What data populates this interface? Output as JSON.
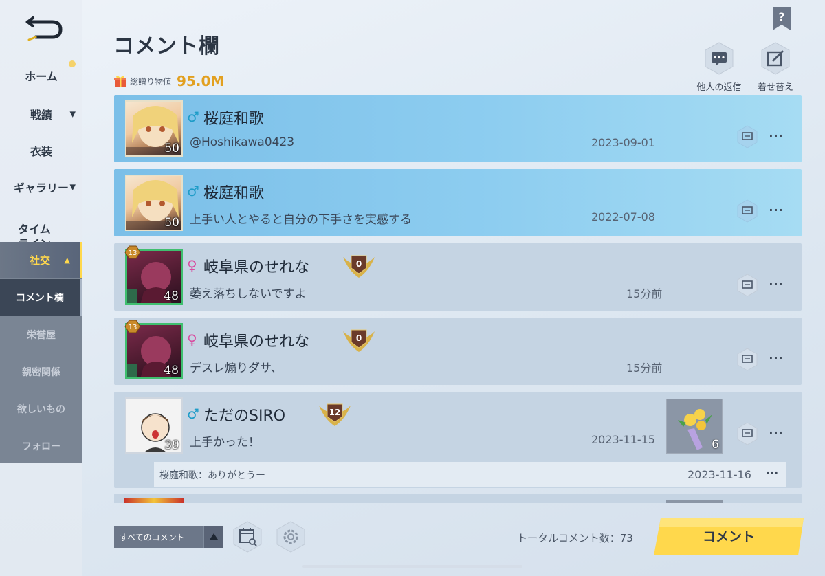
{
  "sidebar": {
    "items": [
      {
        "label": "ホーム"
      },
      {
        "label": "戦績",
        "caret": "▼"
      },
      {
        "label": "衣装"
      },
      {
        "label": "ギャラリー",
        "caret": "▼"
      },
      {
        "label": "タイム\nライン"
      }
    ],
    "group": {
      "label": "社交",
      "caret": "▲",
      "subs": [
        {
          "label": "コメント欄"
        },
        {
          "label": "栄誉屋"
        },
        {
          "label": "親密関係"
        },
        {
          "label": "欲しいもの"
        },
        {
          "label": "フォロー"
        }
      ]
    }
  },
  "header": {
    "title": "コメント欄",
    "gift_label": "総贈り物値",
    "gift_value": "95.0M",
    "actions": [
      {
        "label": "他人の返信",
        "icon": "chat-bubble-icon"
      },
      {
        "label": "着せ替え",
        "icon": "edit-icon"
      }
    ]
  },
  "comments": [
    {
      "style": "blue",
      "gender": "♂",
      "name": "桜庭和歌",
      "level": "50",
      "text": "@Hoshikawa0423",
      "date": "2023-09-01"
    },
    {
      "style": "blue",
      "gender": "♂",
      "name": "桜庭和歌",
      "level": "50",
      "text": "上手い人とやると自分の下手さを実感する",
      "date": "2022-07-08"
    },
    {
      "style": "grey",
      "gender": "♀",
      "name": "岐阜県のせれな",
      "level": "48",
      "rank": "0",
      "frame_level": "13",
      "text": "萎え落ちしないですよ",
      "date": "15分前"
    },
    {
      "style": "grey",
      "gender": "♀",
      "name": "岐阜県のせれな",
      "level": "48",
      "rank": "0",
      "frame_level": "13",
      "text": "デスレ煽りダサ、",
      "date": "15分前"
    },
    {
      "style": "grey",
      "gender": "♂",
      "name": "ただのSIRO",
      "level": "39",
      "rank": "12",
      "text": "上手かった！",
      "date": "2023-11-15",
      "gift_count": "6",
      "reply": {
        "text": "桜庭和歌：ありがとうー",
        "date": "2023-11-16"
      }
    }
  ],
  "footer": {
    "filter_label": "すべてのコメント",
    "total_label": "トータルコメント数：73",
    "comment_button": "コメント"
  },
  "colors": {
    "accent_yellow": "#ffd84c",
    "card_blue": "#8dcdf0",
    "card_grey": "#c5d4e3",
    "male": "#1e9cc8",
    "female": "#d84da0",
    "gift_value": "#e2a020"
  }
}
